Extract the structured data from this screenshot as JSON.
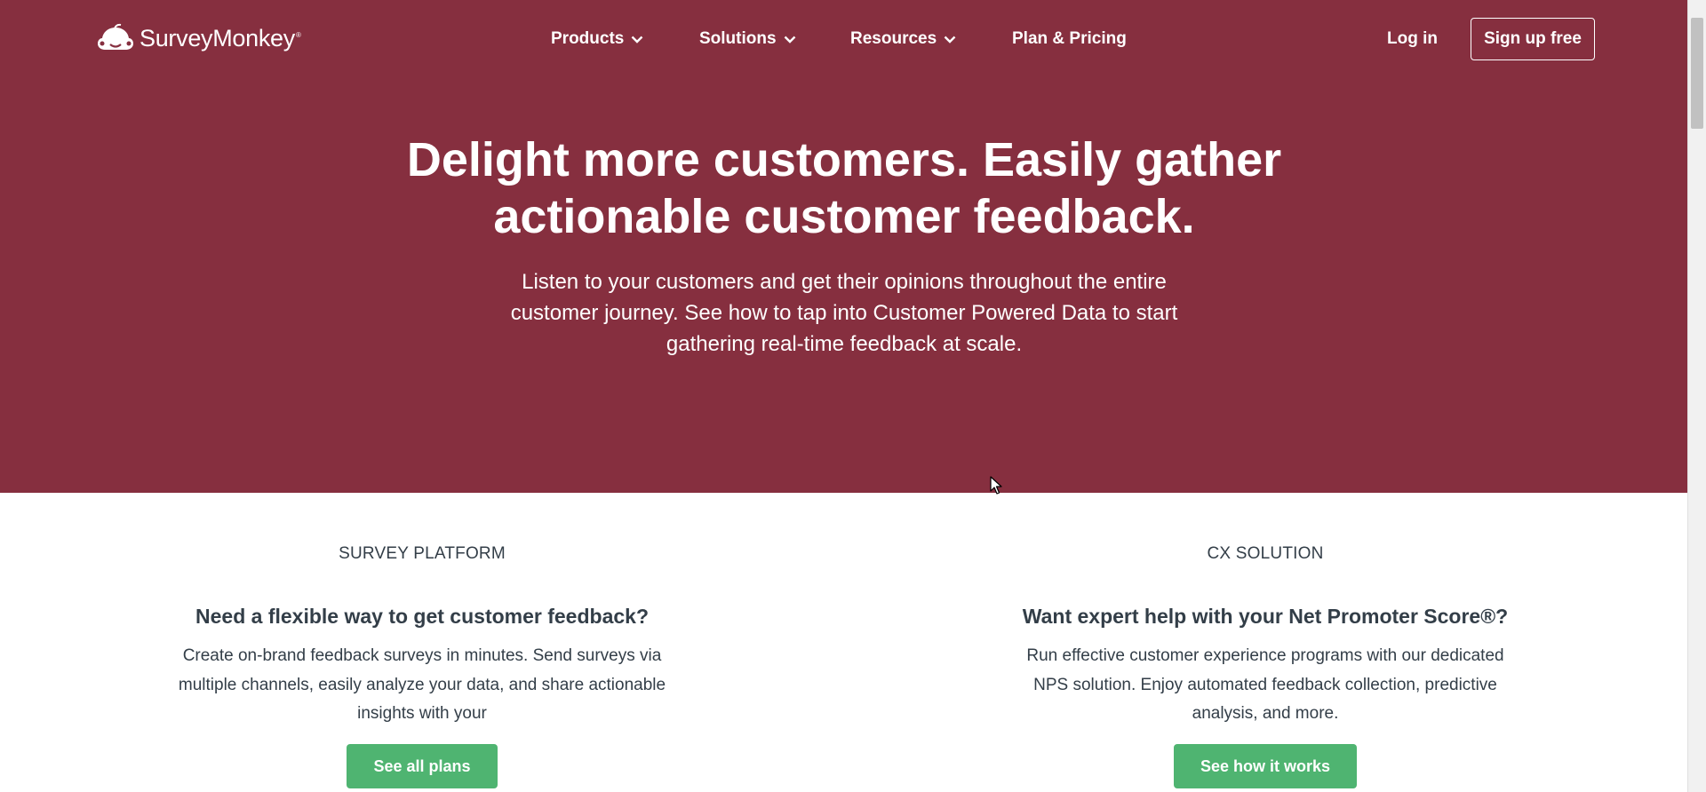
{
  "header": {
    "logo_text": "SurveyMonkey",
    "logo_mark": "®",
    "nav": [
      {
        "label": "Products"
      },
      {
        "label": "Solutions"
      },
      {
        "label": "Resources"
      },
      {
        "label": "Plan & Pricing"
      }
    ],
    "login_label": "Log in",
    "signup_label": "Sign up free"
  },
  "hero": {
    "headline": "Delight more customers. Easily gather actionable customer feedback.",
    "subheadline": "Listen to your customers and get their opinions throughout the entire customer journey. See how to tap into Customer Powered Data to start gathering real-time feedback at scale."
  },
  "columns": [
    {
      "eyebrow": "SURVEY PLATFORM",
      "title": "Need a flexible way to get customer feedback?",
      "text": "Create on-brand feedback surveys in minutes. Send surveys via multiple channels, easily analyze your data, and share actionable insights with your",
      "cta": "See all plans"
    },
    {
      "eyebrow": "CX SOLUTION",
      "title": "Want expert help with your Net Promoter Score®?",
      "text": "Run effective customer experience programs with our dedicated NPS solution. Enjoy automated feedback collection, predictive analysis, and more.",
      "cta": "See how it works"
    }
  ],
  "icons": {
    "logo": "surveymonkey-logo-icon",
    "dropdown": "chevron-down-icon",
    "cursor": "mouse-pointer-icon"
  },
  "colors": {
    "hero_bg": "#862f3f",
    "cta_green": "#4fb471",
    "body_text": "#333e48"
  }
}
